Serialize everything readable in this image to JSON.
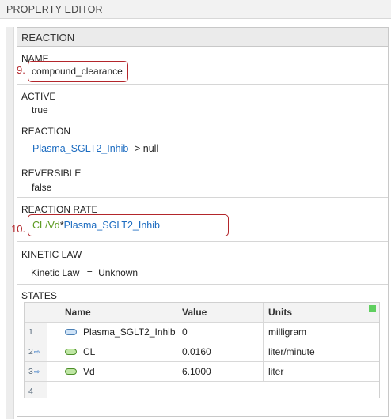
{
  "title": "PROPERTY EDITOR",
  "panel": {
    "header": "REACTION"
  },
  "name": {
    "label": "NAME",
    "value": "compound_clearance",
    "annotation": "9."
  },
  "active": {
    "label": "ACTIVE",
    "value": "true"
  },
  "reaction": {
    "label": "REACTION",
    "species": "Plasma_SGLT2_Inhib",
    "rest": " -> null"
  },
  "reversible": {
    "label": "REVERSIBLE",
    "value": "false"
  },
  "rate": {
    "label": "REACTION RATE",
    "part1": "CL/Vd",
    "op": "*",
    "part2": "Plasma_SGLT2_Inhib",
    "annotation": "10."
  },
  "kinetic": {
    "label": "KINETIC LAW",
    "key": "Kinetic Law",
    "eq": "=",
    "value": "Unknown"
  },
  "states": {
    "label": "STATES",
    "columns": [
      "Name",
      "Value",
      "Units"
    ],
    "rows": [
      {
        "num": "1",
        "name": "Plasma_SGLT2_Inhib",
        "value": "0",
        "units": "milligram",
        "linked": false,
        "color": "blue"
      },
      {
        "num": "2",
        "name": "CL",
        "value": "0.0160",
        "units": "liter/minute",
        "linked": true,
        "color": "green"
      },
      {
        "num": "3",
        "name": "Vd",
        "value": "6.1000",
        "units": "liter",
        "linked": true,
        "color": "green"
      },
      {
        "num": "4",
        "name": "",
        "value": "",
        "units": "",
        "linked": false,
        "color": ""
      }
    ]
  },
  "colors": {
    "accent_blue": "#1b6bc0",
    "accent_green": "#5b9a1f",
    "annotation_red": "#b3262b"
  }
}
